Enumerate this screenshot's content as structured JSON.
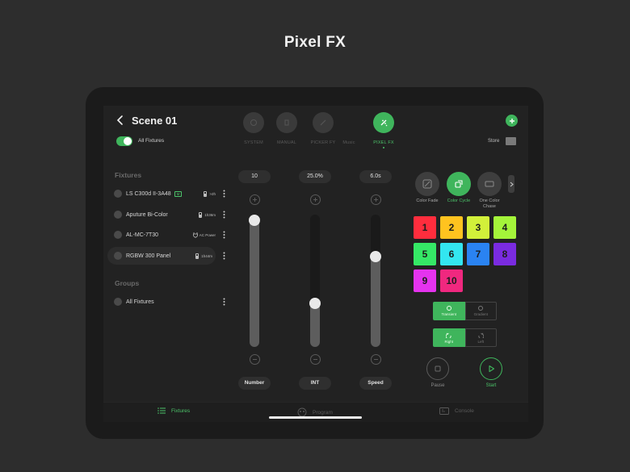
{
  "page": {
    "title": "Pixel FX"
  },
  "header": {
    "scene_title": "Scene 01",
    "all_fixtures_toggle": {
      "label": "All Fixtures",
      "on": true
    },
    "add_label": "+",
    "store_label": "Store"
  },
  "modes": [
    {
      "label": "SYSTEM",
      "icon": "system-icon",
      "active": false
    },
    {
      "label": "MANUAL",
      "icon": "manual-icon",
      "active": false
    },
    {
      "label": "PICKER FY",
      "icon": "picker-icon",
      "active": false
    },
    {
      "label": "Music",
      "icon": "music-icon",
      "active": false
    },
    {
      "label": "PIXEL FX",
      "icon": "pixel-fx-icon",
      "active": true
    }
  ],
  "fixtures": {
    "title": "Fixtures",
    "items": [
      {
        "name": "LS C300d II-3A48",
        "tag": "M",
        "power": ">2h",
        "power_icon": "battery-icon"
      },
      {
        "name": "Aputure Bi-Color",
        "tag": "",
        "power": "1h36m",
        "power_icon": "battery-icon"
      },
      {
        "name": "AL-MC-7T30",
        "tag": "",
        "power": "AC Power",
        "power_icon": "ac-power-icon"
      },
      {
        "name": "RGBW 300 Panel",
        "tag": "",
        "power": "1h44m",
        "power_icon": "battery-icon",
        "selected": true
      }
    ]
  },
  "groups": {
    "title": "Groups",
    "items": [
      {
        "name": "All Fixtures"
      }
    ]
  },
  "sliders": [
    {
      "label": "Number",
      "value": "10",
      "level": 0.96
    },
    {
      "label": "INT",
      "value": "25.0%",
      "level": 0.33
    },
    {
      "label": "Speed",
      "value": "6.0s",
      "level": 0.68
    }
  ],
  "effects": [
    {
      "label": "Color Fade",
      "active": false
    },
    {
      "label": "Color Cycle",
      "active": true
    },
    {
      "label": "One Color Chase",
      "active": false
    }
  ],
  "color_grid": [
    {
      "n": "1",
      "color": "#ff2d3d"
    },
    {
      "n": "2",
      "color": "#ffc31f"
    },
    {
      "n": "3",
      "color": "#d2f03a"
    },
    {
      "n": "4",
      "color": "#a4f43a"
    },
    {
      "n": "5",
      "color": "#35e866"
    },
    {
      "n": "6",
      "color": "#33e6f0"
    },
    {
      "n": "7",
      "color": "#2a83f2"
    },
    {
      "n": "8",
      "color": "#7a2be0"
    },
    {
      "n": "9",
      "color": "#e533ef"
    },
    {
      "n": "10",
      "color": "#f0287f"
    }
  ],
  "transition": {
    "options": [
      "Transient",
      "Gradient"
    ],
    "selected": 0
  },
  "direction": {
    "options": [
      "Right",
      "Left"
    ],
    "selected": 0
  },
  "playback": {
    "pause_label": "Pause",
    "start_label": "Start"
  },
  "tabs": [
    {
      "label": "Fixtures",
      "active": true
    },
    {
      "label": "Program",
      "active": false
    },
    {
      "label": "Console",
      "active": false
    }
  ],
  "accent": "#3fb55c"
}
